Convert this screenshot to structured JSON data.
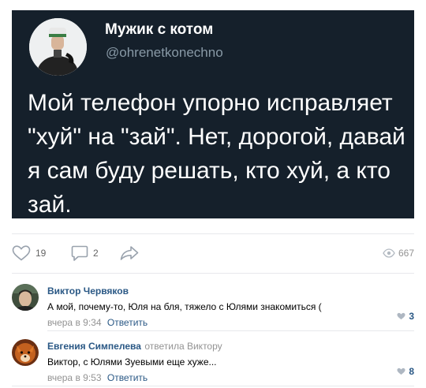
{
  "tweet": {
    "name": "Мужик с котом",
    "handle": "@ohrenetkonechno",
    "text": "Мой телефон упорно исправляет \"хуй\" на \"зай\". Нет, дорогой, давай я сам буду решать, кто хуй, а кто зай."
  },
  "actions": {
    "likes": "19",
    "comments": "2",
    "views": "667"
  },
  "comments": [
    {
      "author": "Виктор Червяков",
      "reply_to": "",
      "text": "А мой, почему-то, Юля на бля, тяжело с Юлями знакомиться (",
      "time": "вчера в 9:34",
      "reply_label": "Ответить",
      "likes": "3"
    },
    {
      "author": "Евгения Симпелева",
      "reply_to": "ответила Виктору",
      "text": "Виктор, с Юлями Зуевыми еще хуже...",
      "time": "вчера в 9:53",
      "reply_label": "Ответить",
      "likes": "8"
    }
  ],
  "colors": {
    "tweet_bg": "#15202b",
    "link": "#2a5885",
    "muted": "#939393"
  }
}
